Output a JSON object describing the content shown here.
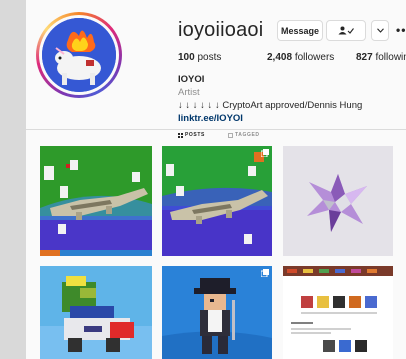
{
  "profile": {
    "username": "ioyoiioaoi",
    "message_label": "Message",
    "follow_icon": "person-check-icon",
    "more_icon": "chevron-down-icon",
    "options_label": "•••",
    "stats": {
      "posts": "100",
      "posts_label": "posts",
      "followers": "2,408",
      "followers_label": "followers",
      "following": "827",
      "following_label": "following"
    },
    "name": "IOYOI",
    "category": "Artist",
    "bio": "↓ ↓ ↓ ↓ ↓ ↓ CryptoArt approved/Dennis Hung",
    "link": "linktr.ee/IOYOI"
  },
  "tabs": [
    {
      "label": "POSTS",
      "icon": "grid-icon",
      "active": true
    },
    {
      "label": "TAGGED",
      "icon": "tag-icon",
      "active": false
    }
  ],
  "posts": [
    {
      "subject": "voxel-crocodile-green",
      "multi": false
    },
    {
      "subject": "voxel-crocodile-blue",
      "multi": true
    },
    {
      "subject": "crystal-star",
      "multi": false
    },
    {
      "subject": "voxel-turtle-truck",
      "multi": false
    },
    {
      "subject": "pirate-figure",
      "multi": true
    },
    {
      "subject": "marketplace-screenshot",
      "multi": false
    }
  ],
  "colors": {
    "link": "#00376b",
    "muted": "#8e8e8e",
    "border": "#dbdbdb"
  }
}
